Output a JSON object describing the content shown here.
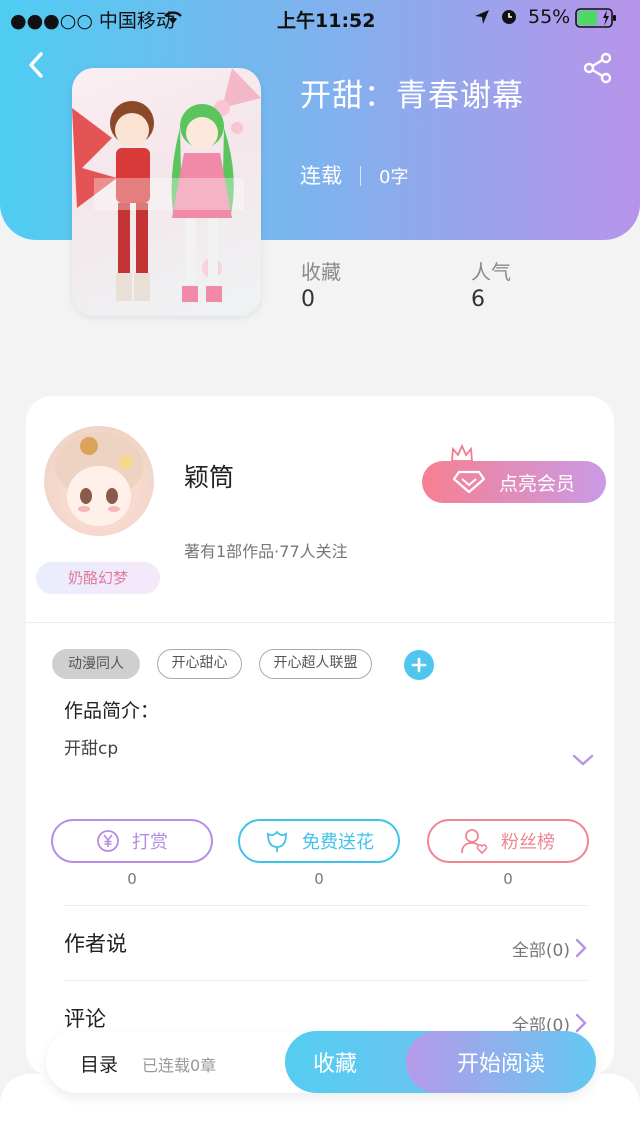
{
  "status_bar": {
    "carrier": "●●●○○ 中国移动",
    "time": "上午11:52",
    "battery": "55%"
  },
  "header": {
    "title": "开甜：青春谢幕",
    "status": "连载",
    "word_count": "0字"
  },
  "stats": {
    "collect_label": "收藏",
    "collect_value": "0",
    "popularity_label": "人气",
    "popularity_value": "6"
  },
  "author": {
    "name": "颖筒",
    "badge": "奶酪幻梦",
    "meta": "著有1部作品·77人关注",
    "vip_label": "点亮会员"
  },
  "tags": [
    "动漫同人",
    "开心甜心",
    "开心超人联盟"
  ],
  "intro": {
    "heading": "作品简介：",
    "text": "开甜cp"
  },
  "actions": [
    {
      "label": "打赏",
      "count": "0",
      "color": "#b78be6"
    },
    {
      "label": "免费送花",
      "count": "0",
      "color": "#3fc3ea"
    },
    {
      "label": "粉丝榜",
      "count": "0",
      "color": "#ef8593"
    }
  ],
  "author_says": {
    "heading": "作者说",
    "link": "全部(0)"
  },
  "comments": {
    "heading": "评论",
    "link": "全部(0)"
  },
  "bottom": {
    "catalog": "目录",
    "catalog_sub": "已连载0章",
    "collect": "收藏",
    "read": "开始阅读"
  },
  "colors": {
    "header_start": "#4fcdf2",
    "header_end": "#b794ea",
    "chevron": "#b694e6"
  }
}
